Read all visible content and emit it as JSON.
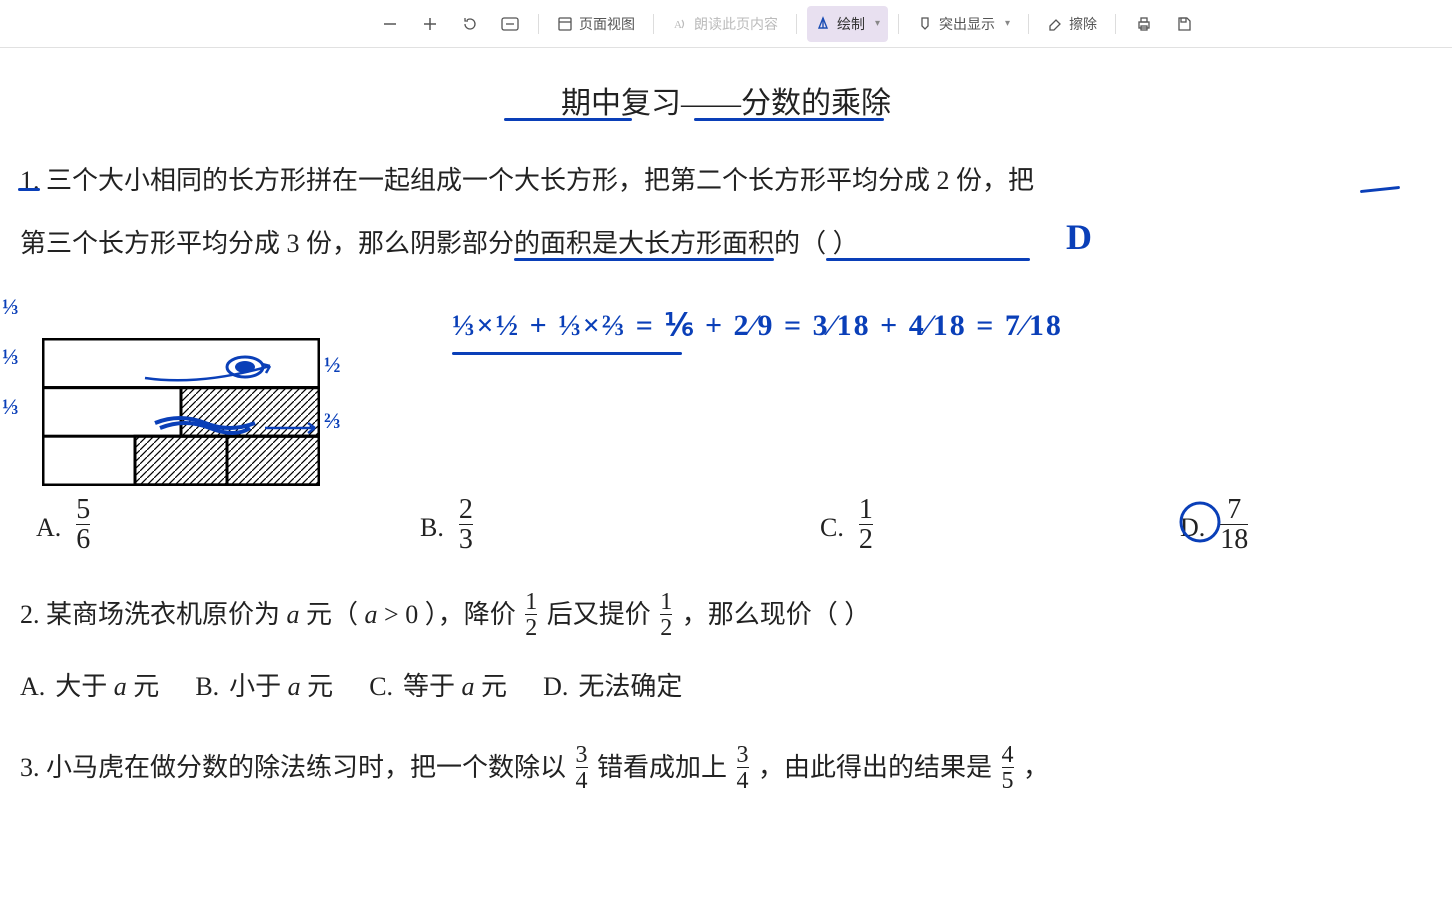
{
  "toolbar": {
    "page_view": "页面视图",
    "read_aloud": "朗读此页内容",
    "draw": "绘制",
    "highlight": "突出显示",
    "erase": "擦除"
  },
  "title": "期中复习——分数的乘除",
  "q1": {
    "line1": "1.  三个大小相同的长方形拼在一起组成一个大长方形，把第二个长方形平均分成 2 份，把",
    "line2_a": "第三个长方形平均分成 3 份，那么",
    "line2_b": "阴影部分的面积",
    "line2_c": "是",
    "line2_d": "大长方形面积的",
    "line2_e": "（           ）",
    "optA": "A.",
    "fracA_n": "5",
    "fracA_d": "6",
    "optB": "B.",
    "fracB_n": "2",
    "fracB_d": "3",
    "optC": "C.",
    "fracC_n": "1",
    "fracC_d": "2",
    "optD": "D.",
    "fracD_n": "7",
    "fracD_d": "18"
  },
  "q2": {
    "line_a": "2.  某商场洗衣机原价为 ",
    "line_b": " 元（ ",
    "line_c": " > 0 ），降价 ",
    "frac1_n": "1",
    "frac1_d": "2",
    "line_d": " 后又提价 ",
    "frac2_n": "1",
    "frac2_d": "2",
    "line_e": " ，那么现价（        ）",
    "optA_l": "A.",
    "optA": "大于 ",
    "optA_end": " 元",
    "optB_l": "B.",
    "optB": "小于 ",
    "optB_end": " 元",
    "optC_l": "C.",
    "optC": "等于 ",
    "optC_end": " 元",
    "optD_l": "D.",
    "optD": "无法确定"
  },
  "q3": {
    "line_a": "3.  小马虎在做分数的除法练习时，把一个数除以 ",
    "f1_n": "3",
    "f1_d": "4",
    "line_b": " 错看成加上 ",
    "f2_n": "3",
    "f2_d": "4",
    "line_c": " ，由此得出的结果是 ",
    "f3_n": "4",
    "f3_d": "5",
    "line_d": " ，"
  },
  "ink": {
    "answer_letter": "D",
    "work": "⅓×½ + ⅓×⅔ = ⅙ + 2⁄9 = 3⁄18 + 4⁄18 = 7⁄18",
    "row1": "⅓",
    "row2": "⅓",
    "row3": "⅓",
    "right1": "½",
    "right2": "⅔",
    "circle_d": "D"
  }
}
